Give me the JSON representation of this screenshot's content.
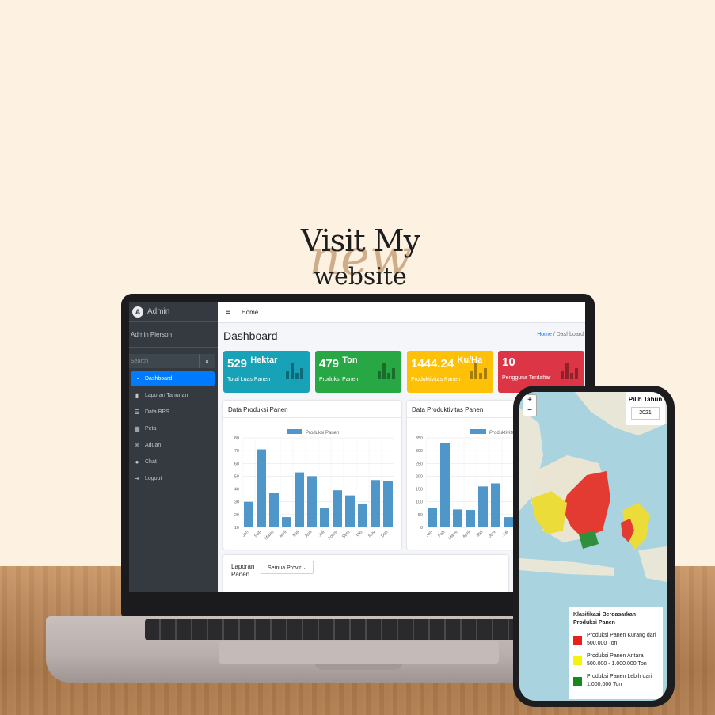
{
  "headline": {
    "line1": "Visit My",
    "line2": "new",
    "line3": "website"
  },
  "app": {
    "brand": "Admin",
    "brand_logo": "A",
    "user": "Admin Pierson",
    "search_placeholder": "Search",
    "nav": [
      {
        "label": "Dashboard",
        "icon": "dashboard-icon",
        "active": true
      },
      {
        "label": "Laporan Tahunan",
        "icon": "file-icon"
      },
      {
        "label": "Data BPS",
        "icon": "list-icon"
      },
      {
        "label": "Peta",
        "icon": "map-icon"
      },
      {
        "label": "Aduan",
        "icon": "envelope-icon"
      },
      {
        "label": "Chat",
        "icon": "chat-icon"
      },
      {
        "label": "Logout",
        "icon": "logout-icon"
      }
    ],
    "topbar_home": "Home",
    "page_title": "Dashboard",
    "breadcrumb": {
      "home": "Home",
      "sep": "/",
      "current": "Dashboard"
    },
    "stats": [
      {
        "value": "529",
        "unit": "Hektar",
        "label": "Total Luas Panen",
        "color": "#17a2b8"
      },
      {
        "value": "479",
        "unit": "Ton",
        "label": "Produksi Panen",
        "color": "#28a745"
      },
      {
        "value": "1444.24",
        "unit": "Ku/Ha",
        "label": "Produktivitas Panen",
        "color": "#ffc107"
      },
      {
        "value": "10",
        "unit": "",
        "label": "Pengguna Terdaftar",
        "color": "#dc3545"
      }
    ],
    "card1_title": "Data Produksi Panen",
    "card2_title": "Data Produktivitas Panen",
    "laporan_label": "Laporan Panen",
    "laporan_select": "Semua Provir"
  },
  "chart_data": [
    {
      "type": "bar",
      "legend": "Produksi Panen",
      "categories": [
        "Jan",
        "Feb",
        "Maret",
        "April",
        "Mei",
        "Juni",
        "Juli",
        "Agust",
        "Sept",
        "Okt",
        "Nov",
        "Des"
      ],
      "values": [
        30,
        71,
        37,
        18,
        53,
        50,
        25,
        39,
        35,
        28,
        47,
        46
      ],
      "ylim": [
        10,
        80
      ],
      "yticks": [
        10,
        20,
        30,
        40,
        50,
        60,
        70,
        80
      ],
      "color": "#4f97c8"
    },
    {
      "type": "bar",
      "legend": "Produktivitas P",
      "categories": [
        "Jan",
        "Feb",
        "Maret",
        "April",
        "Mei",
        "Juni",
        "Juli"
      ],
      "values": [
        75,
        330,
        70,
        68,
        160,
        172,
        40
      ],
      "ylim": [
        0,
        350
      ],
      "yticks": [
        0,
        50,
        100,
        150,
        200,
        250,
        300,
        350
      ],
      "color": "#4f97c8"
    }
  ],
  "map": {
    "zoom_in": "+",
    "zoom_out": "−",
    "year_title": "Pilih Tahun",
    "year_value": "2021",
    "legend_title": "Klasifikasi Berdasarkan Produksi Panen",
    "legend_items": [
      {
        "color": "#e8201c",
        "label": "Produksi Panen Kurang dari 500.000 Ton"
      },
      {
        "color": "#f5f20f",
        "label": "Produksi Panen Antara 500.000 - 1.000.000 Ton"
      },
      {
        "color": "#138a1b",
        "label": "Produksi Panen Lebih dari 1.000.000 Ton"
      }
    ]
  }
}
